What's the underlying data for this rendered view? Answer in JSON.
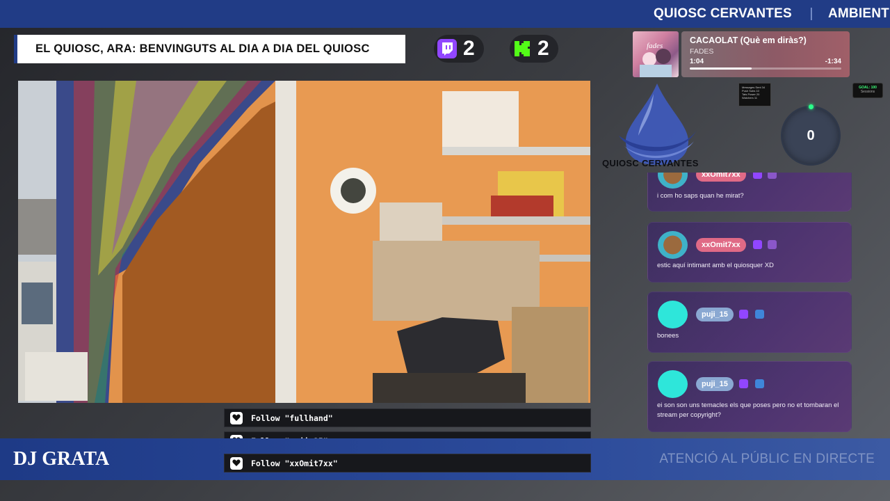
{
  "top_bar": {
    "items": [
      "QUIOSC CERVANTES",
      "AMBIENT"
    ],
    "separator": "|"
  },
  "title_box": {
    "text": "EL QUIOSC, ARA: BENVINGUTS AL DIA A DIA DEL QUIOSC"
  },
  "counters": {
    "twitch": {
      "icon": "twitch-icon",
      "value": "2",
      "color": "#9146ff"
    },
    "kick": {
      "icon": "kick-icon",
      "value": "2",
      "color": "#53fc18"
    }
  },
  "now_playing": {
    "title": "CACAOLAT (Què em diràs?)",
    "artist": "FADES",
    "elapsed": "1:04",
    "remaining": "-1:34",
    "progress": 0.41
  },
  "mini_stats": {
    "lines": [
      "Messages Sent 34",
      "Push Subs 10",
      "Tats Power 20",
      "Watchers 11"
    ]
  },
  "goal_badge": {
    "label": "GOAL: 100",
    "sub": "Sessions"
  },
  "circle_counter": {
    "value": "0"
  },
  "logo": {
    "text": "QUIOSC CERVANTES",
    "color": "#3f5bbf"
  },
  "chat": {
    "messages": [
      {
        "user": "xxOmit7xx",
        "text": "i com ho saps quan he mirat?",
        "avatar": "cat-avatar",
        "name_color": "red"
      },
      {
        "user": "xxOmit7xx",
        "text": "estic aquí intimant amb el quiosquer XD",
        "avatar": "cat-avatar",
        "name_color": "red"
      },
      {
        "user": "puji_15",
        "text": "bonees",
        "avatar": "user-avatar",
        "name_color": "blue"
      },
      {
        "user": "puji_15",
        "text": "ei son son uns temacles els que poses pero no et tombaran el stream per copyright?",
        "avatar": "user-avatar",
        "name_color": "blue"
      }
    ]
  },
  "follows": [
    {
      "text": "Follow \"fullhand\""
    },
    {
      "text": "Follow \"puji_15\""
    },
    {
      "text": "Follow \"xxOmit7xx\""
    }
  ],
  "bottom_bar": {
    "dj": "DJ GRATA",
    "status": "ATENCIÓ AL PÚBLIC EN DIRECTE"
  }
}
